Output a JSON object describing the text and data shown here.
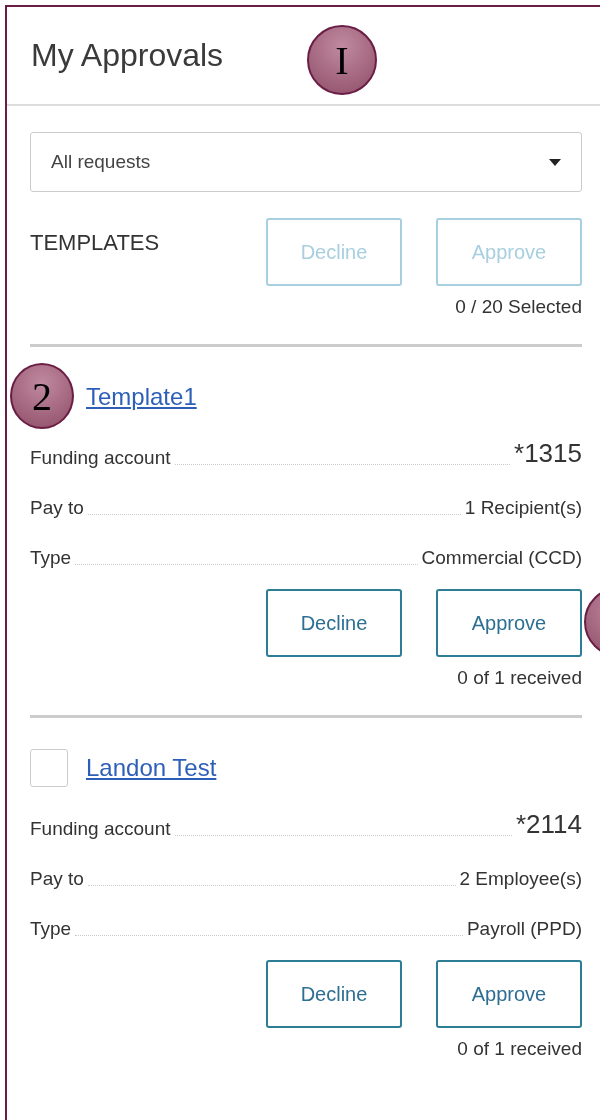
{
  "header": {
    "title": "My Approvals",
    "badge": "I"
  },
  "filter": {
    "value": "All requests"
  },
  "section": {
    "title": "TEMPLATES",
    "buttons": [
      {
        "label": "Decline",
        "disabled": true
      },
      {
        "label": "Approve",
        "disabled": true
      }
    ],
    "selection": "0 / 20 Selected"
  },
  "items": [
    {
      "name": "Template1",
      "badge": "2",
      "fields": [
        {
          "label": "Funding account",
          "value": "*1315",
          "kind": "large"
        },
        {
          "label": "Pay to",
          "value": "1 Recipient(s)",
          "kind": "normal"
        },
        {
          "label": "Type",
          "value": "Commercial (CCD)",
          "kind": "normal"
        }
      ],
      "buttons": [
        {
          "label": "Decline",
          "disabled": false
        },
        {
          "label": "Approve",
          "disabled": false,
          "marker": true
        }
      ],
      "status": "0 of 1 received"
    },
    {
      "name": "Landon Test",
      "checked": false,
      "fields": [
        {
          "label": "Funding account",
          "value": "*2114",
          "kind": "large"
        },
        {
          "label": "Pay to",
          "value": "2 Employee(s)",
          "kind": "normal"
        },
        {
          "label": "Type",
          "value": "Payroll (PPD)",
          "kind": "normal"
        }
      ],
      "buttons": [
        {
          "label": "Decline",
          "disabled": false
        },
        {
          "label": "Approve",
          "disabled": false
        }
      ],
      "status": "0 of 1 received"
    }
  ]
}
